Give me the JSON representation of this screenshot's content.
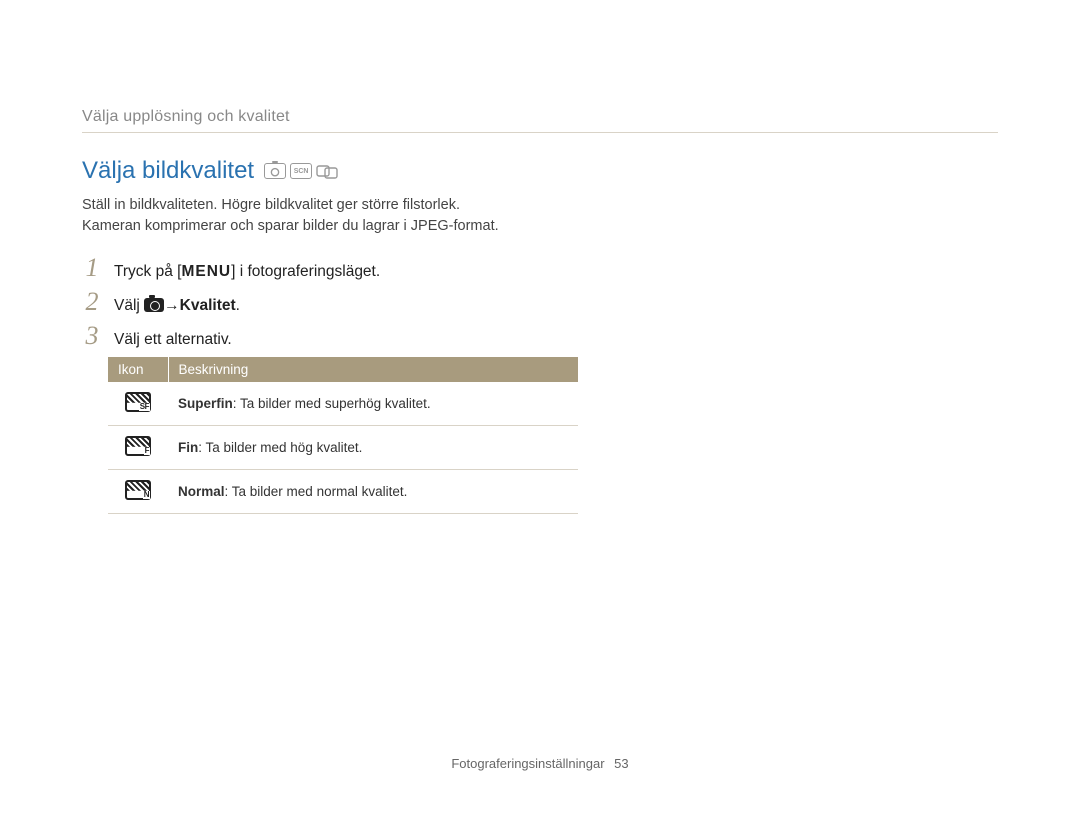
{
  "breadcrumb": "Välja upplösning och kvalitet",
  "heading": "Välja bildkvalitet",
  "mode_icons": [
    "camera-p-mode-icon",
    "scn-mode-icon",
    "dual-mode-icon"
  ],
  "intro_line1": "Ställ in bildkvaliteten. Högre bildkvalitet ger större filstorlek.",
  "intro_line2": "Kameran komprimerar och sparar bilder du lagrar i JPEG-format.",
  "steps": {
    "s1_a": "Tryck på [",
    "s1_menu": "MENU",
    "s1_b": "] i fotograferingsläget.",
    "s2_a": "Välj ",
    "s2_arrow": " → ",
    "s2_bold": "Kvalitet",
    "s2_b": ".",
    "s3": "Välj ett alternativ."
  },
  "table": {
    "headers": {
      "col1": "Ikon",
      "col2": "Beskrivning"
    },
    "rows": [
      {
        "icon_sub": "SF",
        "label": "Superfin",
        "desc": ": Ta bilder med superhög kvalitet."
      },
      {
        "icon_sub": "F",
        "label": "Fin",
        "desc": ": Ta bilder med hög kvalitet."
      },
      {
        "icon_sub": "N",
        "label": "Normal",
        "desc": ": Ta bilder med normal kvalitet."
      }
    ]
  },
  "footer": {
    "section": "Fotograferingsinställningar",
    "page": "53"
  }
}
